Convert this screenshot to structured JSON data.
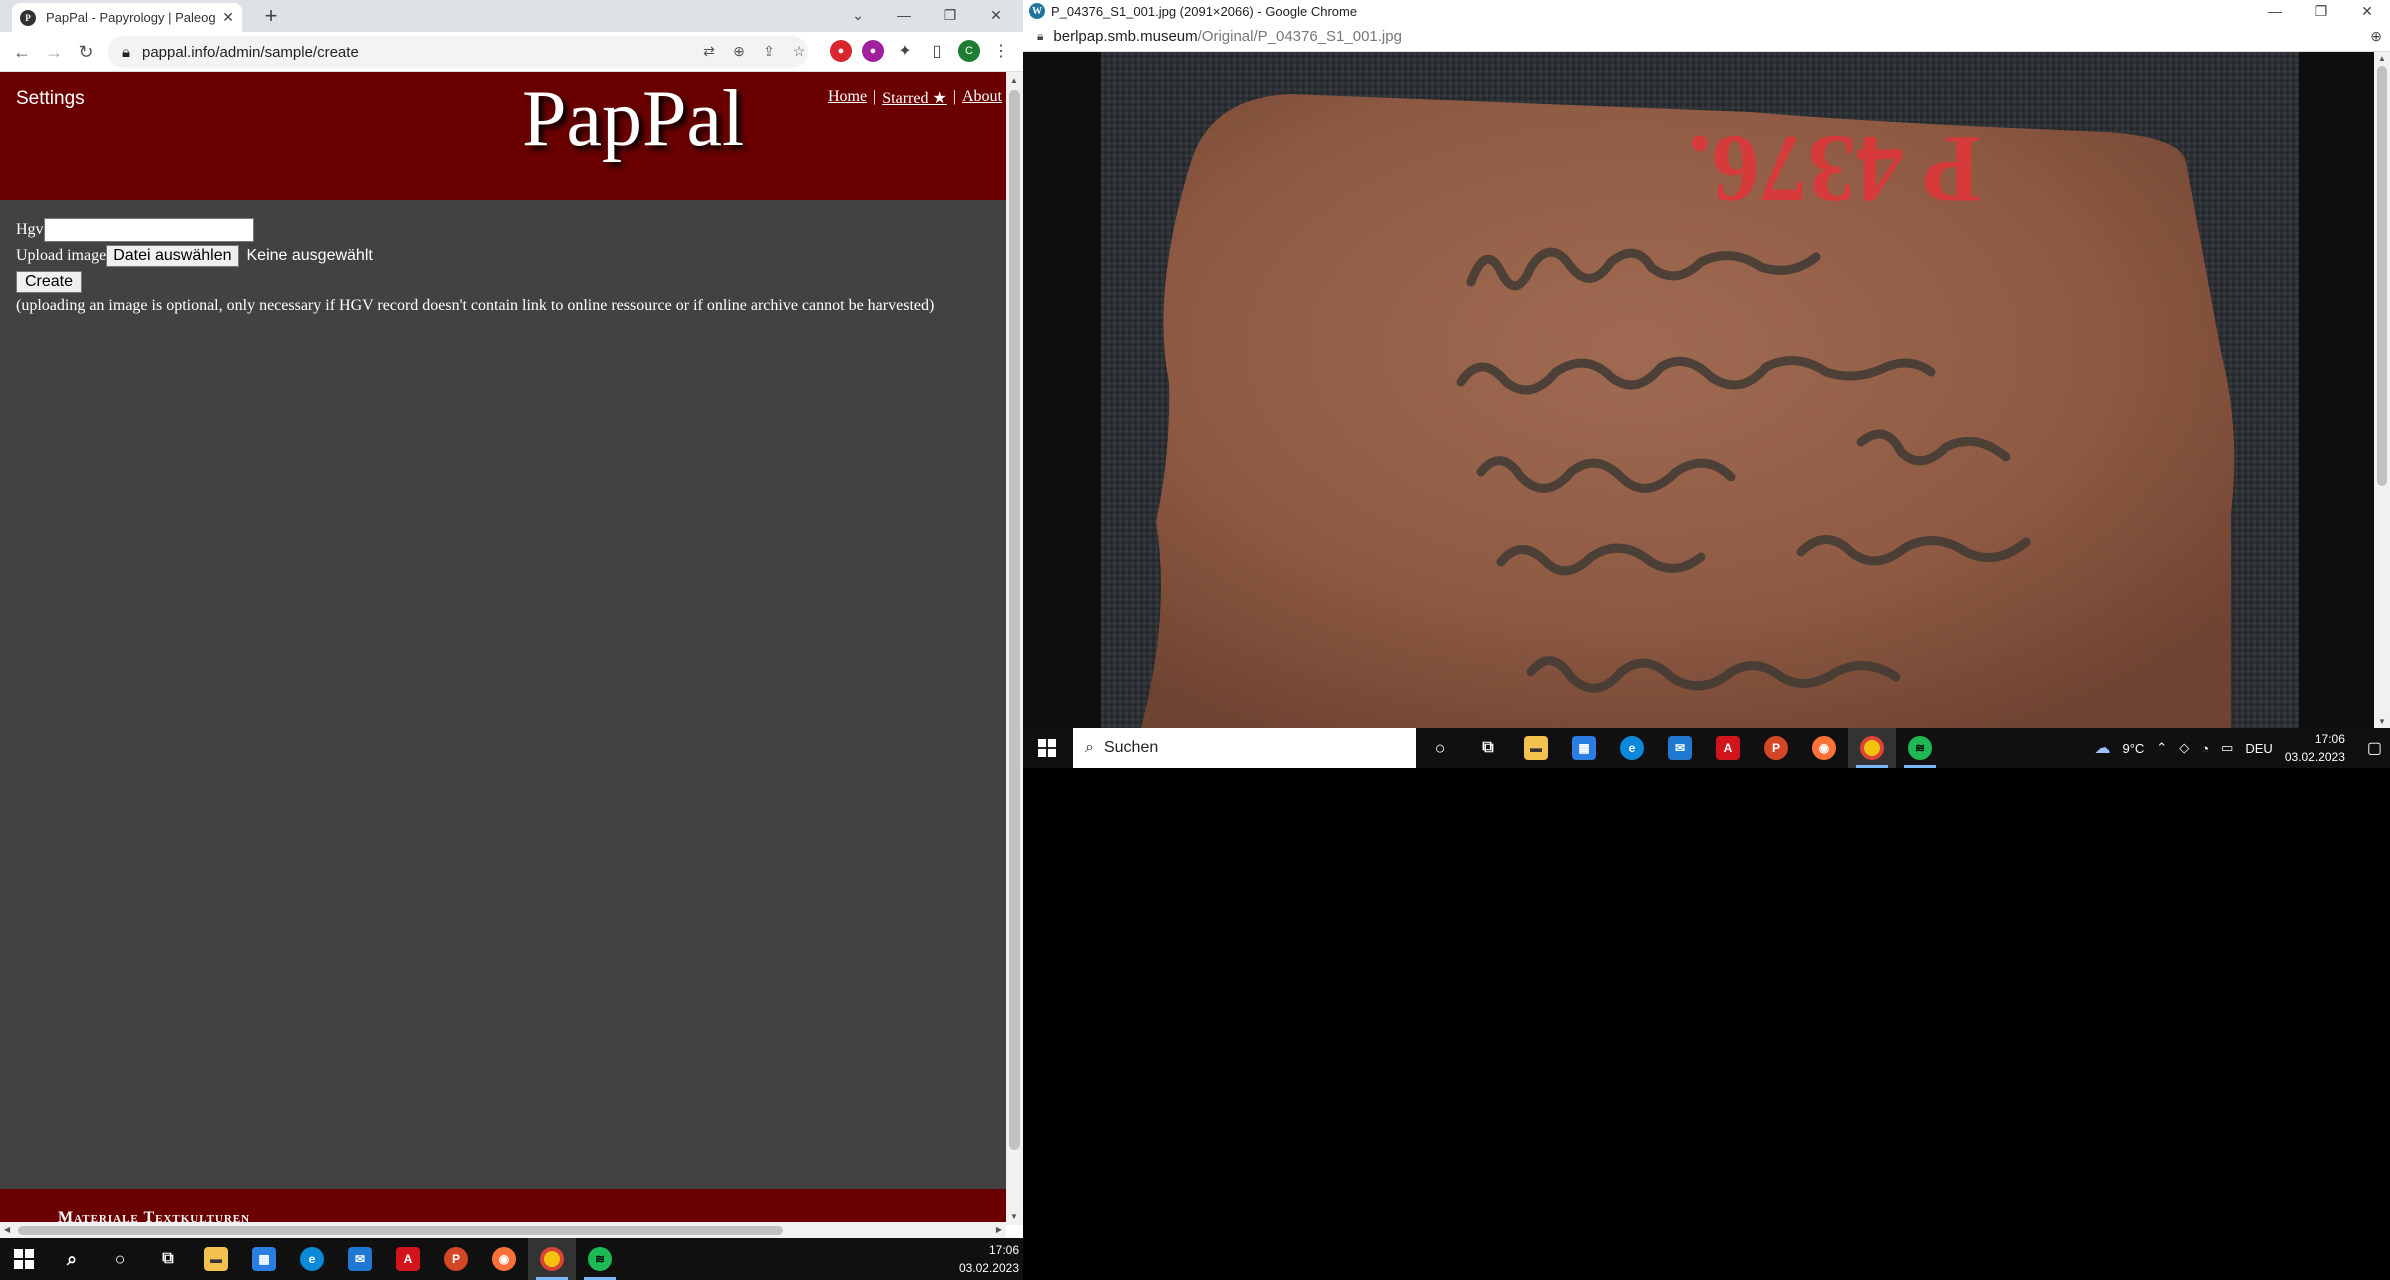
{
  "left_browser": {
    "tab_title": "PapPal - Papyrology | Paleograph",
    "favicon_text": "P",
    "url": "pappal.info/admin/sample/create",
    "profile_letter": "C"
  },
  "page": {
    "settings_label": "Settings",
    "logo_text": "PapPal",
    "nav": {
      "home": "Home",
      "sep": "|",
      "starred": "Starred ★",
      "about": "About"
    },
    "hgv_label": "Hgv",
    "upload_label": "Upload image",
    "file_button": "Datei auswählen",
    "file_status": "Keine ausgewählt",
    "create_button": "Create",
    "note": "(uploading an image is optional, only necessary if HGV record doesn't contain link to online ressource or if online archive cannot be harvested)",
    "footer_text": "Materiale Textkulturen"
  },
  "left_taskbar": {
    "time": "17:06",
    "date": "03.02.2023"
  },
  "right_browser": {
    "title": "P_04376_S1_001.jpg (2091×2066) - Google Chrome",
    "favicon_text": "W",
    "url_host": "berlpap.smb.museum",
    "url_path": "/Original/P_04376_S1_001.jpg",
    "image_label": "P 4376."
  },
  "right_taskbar": {
    "search_placeholder": "Suchen",
    "weather": "9°C",
    "lang": "DEU",
    "time": "17:06",
    "date": "03.02.2023"
  },
  "colors": {
    "header": "#6a0000",
    "page_bg": "#424242",
    "taskbar": "#101010"
  }
}
